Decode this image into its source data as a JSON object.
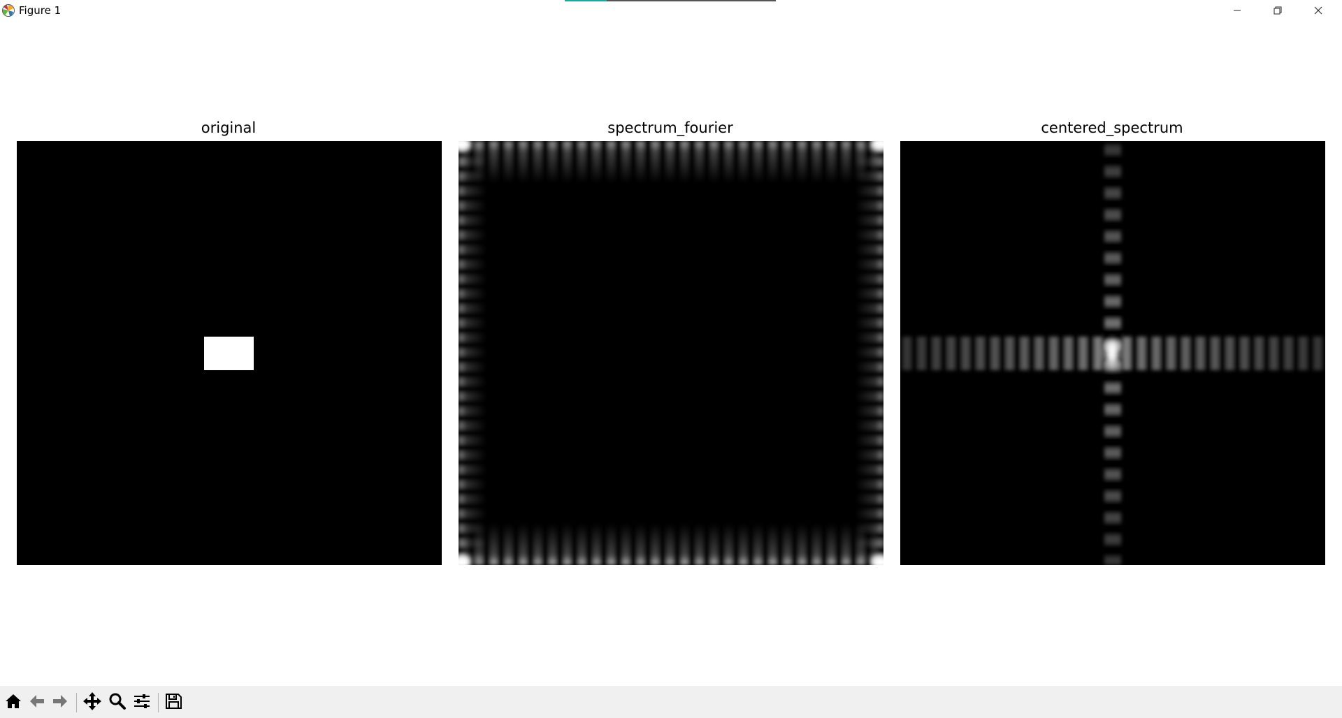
{
  "window": {
    "title": "Figure 1",
    "icons": [
      "matplotlib-logo-icon",
      "minimize-icon",
      "maximize-icon",
      "close-icon"
    ]
  },
  "chart_data": [
    {
      "type": "heatmap",
      "title": "original",
      "description_colormap": "gray",
      "grid": false,
      "image": {
        "background": 0,
        "rectangle": {
          "value": 1
        }
      }
    },
    {
      "type": "heatmap",
      "title": "spectrum_fourier",
      "description_colormap": "gray",
      "grid": false
    },
    {
      "type": "heatmap",
      "title": "centered_spectrum",
      "description_colormap": "gray",
      "grid": false
    }
  ],
  "toolbar": {
    "icons": [
      "home-icon",
      "back-icon",
      "forward-icon",
      "pan-icon",
      "zoom-icon",
      "configure-icon",
      "save-icon"
    ]
  },
  "colors": {
    "background": "#ffffff",
    "toolbar": "#f0f0f0",
    "accent": "#21a49b"
  }
}
